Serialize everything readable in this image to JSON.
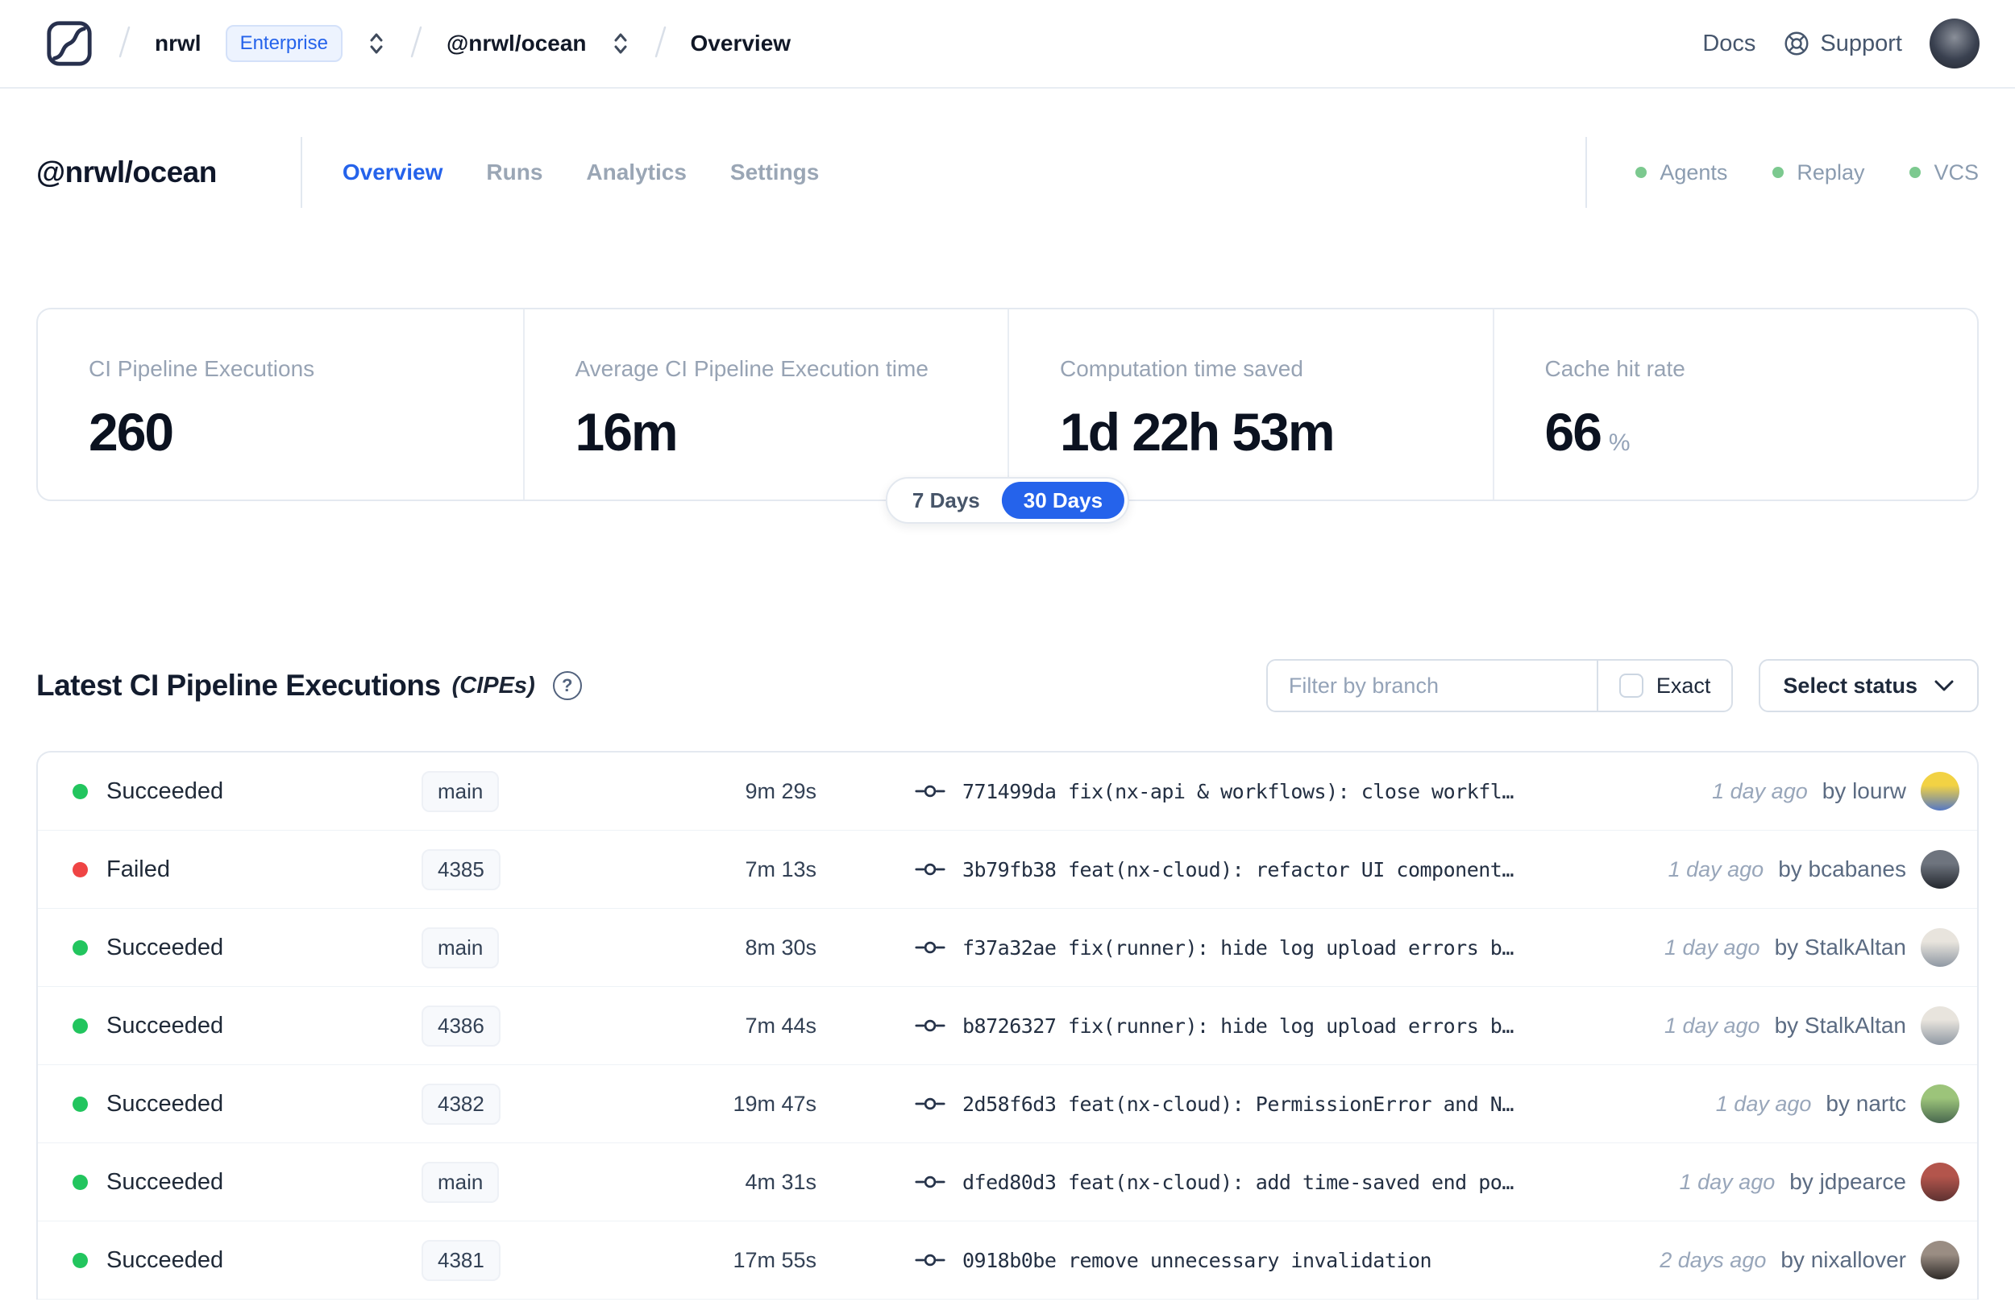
{
  "topbar": {
    "breadcrumb": {
      "org": "nrwl",
      "badge": "Enterprise",
      "workspace": "@nrwl/ocean",
      "page": "Overview"
    },
    "links": {
      "docs": "Docs",
      "support": "Support"
    }
  },
  "header": {
    "title": "@nrwl/ocean",
    "tabs": [
      {
        "label": "Overview",
        "active": true
      },
      {
        "label": "Runs",
        "active": false
      },
      {
        "label": "Analytics",
        "active": false
      },
      {
        "label": "Settings",
        "active": false
      }
    ],
    "indicators": [
      {
        "label": "Agents"
      },
      {
        "label": "Replay"
      },
      {
        "label": "VCS"
      }
    ]
  },
  "stats": {
    "cards": [
      {
        "label": "CI Pipeline Executions",
        "value": "260",
        "suffix": ""
      },
      {
        "label": "Average CI Pipeline Execution time",
        "value": "16m",
        "suffix": ""
      },
      {
        "label": "Computation time saved",
        "value": "1d 22h 53m",
        "suffix": ""
      },
      {
        "label": "Cache hit rate",
        "value": "66",
        "suffix": "%"
      }
    ],
    "range_toggle": {
      "options": [
        "7 Days",
        "30 Days"
      ],
      "selected": "30 Days"
    }
  },
  "cipes": {
    "title": "Latest CI Pipeline Executions",
    "title_suffix": "(CIPEs)",
    "help_icon_glyph": "?",
    "filter": {
      "placeholder": "Filter by branch",
      "exact_label": "Exact",
      "exact_checked": false,
      "status_label": "Select status"
    },
    "rows": [
      {
        "status": "Succeeded",
        "status_color": "green",
        "branch": "main",
        "duration": "9m 29s",
        "commit": "771499da fix(nx-api & workflows): close workfl…",
        "time": "1 day ago",
        "author": "by lourw",
        "avatar": {
          "top": "#f2d244",
          "bottom": "#5578c4"
        }
      },
      {
        "status": "Failed",
        "status_color": "red",
        "branch": "4385",
        "duration": "7m 13s",
        "commit": "3b79fb38 feat(nx-cloud): refactor UI component…",
        "time": "1 day ago",
        "author": "by bcabanes",
        "avatar": {
          "top": "#6e747e",
          "bottom": "#23272e"
        }
      },
      {
        "status": "Succeeded",
        "status_color": "green",
        "branch": "main",
        "duration": "8m 30s",
        "commit": "f37a32ae fix(runner): hide log upload errors b…",
        "time": "1 day ago",
        "author": "by StalkAltan",
        "avatar": {
          "top": "#e8e4dd",
          "bottom": "#8f98a3"
        }
      },
      {
        "status": "Succeeded",
        "status_color": "green",
        "branch": "4386",
        "duration": "7m 44s",
        "commit": "b8726327 fix(runner): hide log upload errors b…",
        "time": "1 day ago",
        "author": "by StalkAltan",
        "avatar": {
          "top": "#e8e4dd",
          "bottom": "#8f98a3"
        }
      },
      {
        "status": "Succeeded",
        "status_color": "green",
        "branch": "4382",
        "duration": "19m 47s",
        "commit": "2d58f6d3 feat(nx-cloud): PermissionError and N…",
        "time": "1 day ago",
        "author": "by nartc",
        "avatar": {
          "top": "#9cc47a",
          "bottom": "#49684f"
        }
      },
      {
        "status": "Succeeded",
        "status_color": "green",
        "branch": "main",
        "duration": "4m 31s",
        "commit": "dfed80d3 feat(nx-cloud): add time-saved end po…",
        "time": "1 day ago",
        "author": "by jdpearce",
        "avatar": {
          "top": "#b3554c",
          "bottom": "#5e3231"
        }
      },
      {
        "status": "Succeeded",
        "status_color": "green",
        "branch": "4381",
        "duration": "17m 55s",
        "commit": "0918b0be remove unnecessary invalidation",
        "time": "2 days ago",
        "author": "by nixallover",
        "avatar": {
          "top": "#9a8d83",
          "bottom": "#2e2a28"
        }
      }
    ]
  },
  "colors": {
    "accent_blue": "#2563eb",
    "success_green": "#22c55e",
    "failed_red": "#ef4444",
    "indicator_green": "#7cc98f"
  }
}
